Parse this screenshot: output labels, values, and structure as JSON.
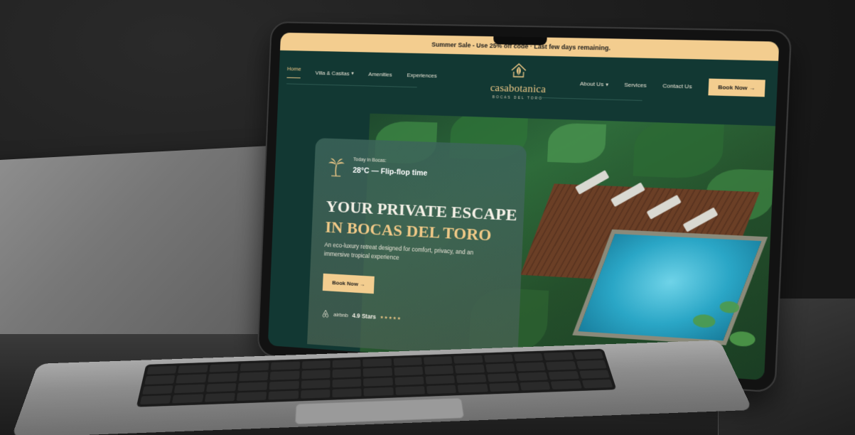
{
  "sale_bar": {
    "text": "Summer Sale - Use 25% off code · Last few days remaining."
  },
  "nav": {
    "left": [
      {
        "label": "Home",
        "active": true,
        "has_caret": false
      },
      {
        "label": "Villa & Casitas",
        "active": false,
        "has_caret": true
      },
      {
        "label": "Amenities",
        "active": false,
        "has_caret": false
      },
      {
        "label": "Experiences",
        "active": false,
        "has_caret": false
      }
    ],
    "right": [
      {
        "label": "About Us",
        "has_caret": true
      },
      {
        "label": "Services",
        "has_caret": false
      },
      {
        "label": "Contact Us",
        "has_caret": false
      }
    ],
    "book_label": "Book Now  →"
  },
  "logo": {
    "name": "casabotanica",
    "sub": "BOCAS DEL TORO"
  },
  "hero": {
    "weather_label": "Today in Bocas:",
    "weather_value": "28°C — Flip-flop time",
    "headline_line1": "YOUR PRIVATE ESCAPE",
    "headline_line2": "IN BOCAS DEL TORO",
    "tagline": "An eco-luxury retreat designed for comfort, privacy, and an immersive tropical experience",
    "book_label": "Book Now  →",
    "rating_source": "airbnb",
    "rating_text": "4.9 Stars",
    "stars": "★★★★★"
  },
  "colors": {
    "accent": "#f3cd8f",
    "background": "#123833",
    "gold_text": "#f0c987"
  },
  "icons": {
    "logo": "house-leaf-icon",
    "weather": "palm-tree-icon",
    "rating": "airbnb-icon"
  }
}
